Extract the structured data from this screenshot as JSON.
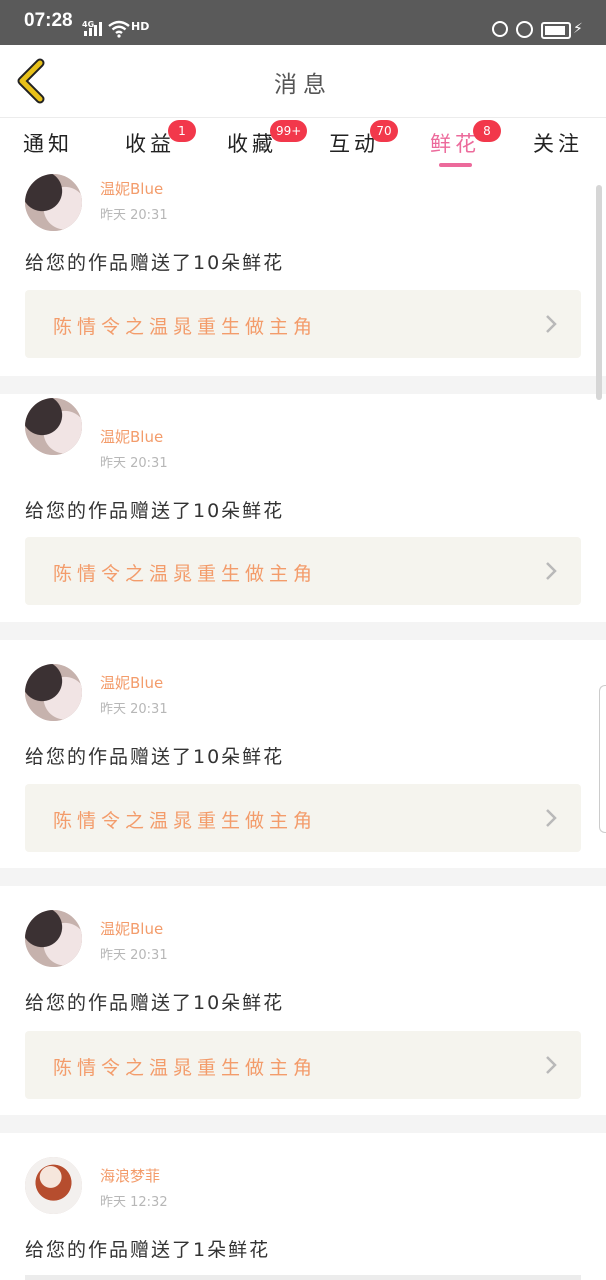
{
  "status_bar": {
    "time": "07:28",
    "network": "4G",
    "hd": "HD"
  },
  "header": {
    "title": "消息"
  },
  "tabs": [
    {
      "label": "通知",
      "badge": ""
    },
    {
      "label": "收益",
      "badge": "1"
    },
    {
      "label": "收藏",
      "badge": "99+"
    },
    {
      "label": "互动",
      "badge": "70"
    },
    {
      "label": "鲜花",
      "badge": "8",
      "active": true
    },
    {
      "label": "关注",
      "badge": ""
    }
  ],
  "messages": [
    {
      "user": "温妮Blue",
      "time": "昨天 20:31",
      "text": "给您的作品赠送了10朵鲜花",
      "work": "陈情令之温晁重生做主角"
    },
    {
      "user": "温妮Blue",
      "time": "昨天 20:31",
      "text": "给您的作品赠送了10朵鲜花",
      "work": "陈情令之温晁重生做主角"
    },
    {
      "user": "温妮Blue",
      "time": "昨天 20:31",
      "text": "给您的作品赠送了10朵鲜花",
      "work": "陈情令之温晁重生做主角"
    },
    {
      "user": "温妮Blue",
      "time": "昨天 20:31",
      "text": "给您的作品赠送了10朵鲜花",
      "work": "陈情令之温晁重生做主角"
    },
    {
      "user": "海浪梦菲",
      "time": "昨天 12:32",
      "text": "给您的作品赠送了1朵鲜花",
      "work": ""
    }
  ],
  "colors": {
    "accent": "#ec6a9b",
    "badge": "#f2384b",
    "username": "#f39c6b",
    "back_icon": "#e8c11a"
  }
}
